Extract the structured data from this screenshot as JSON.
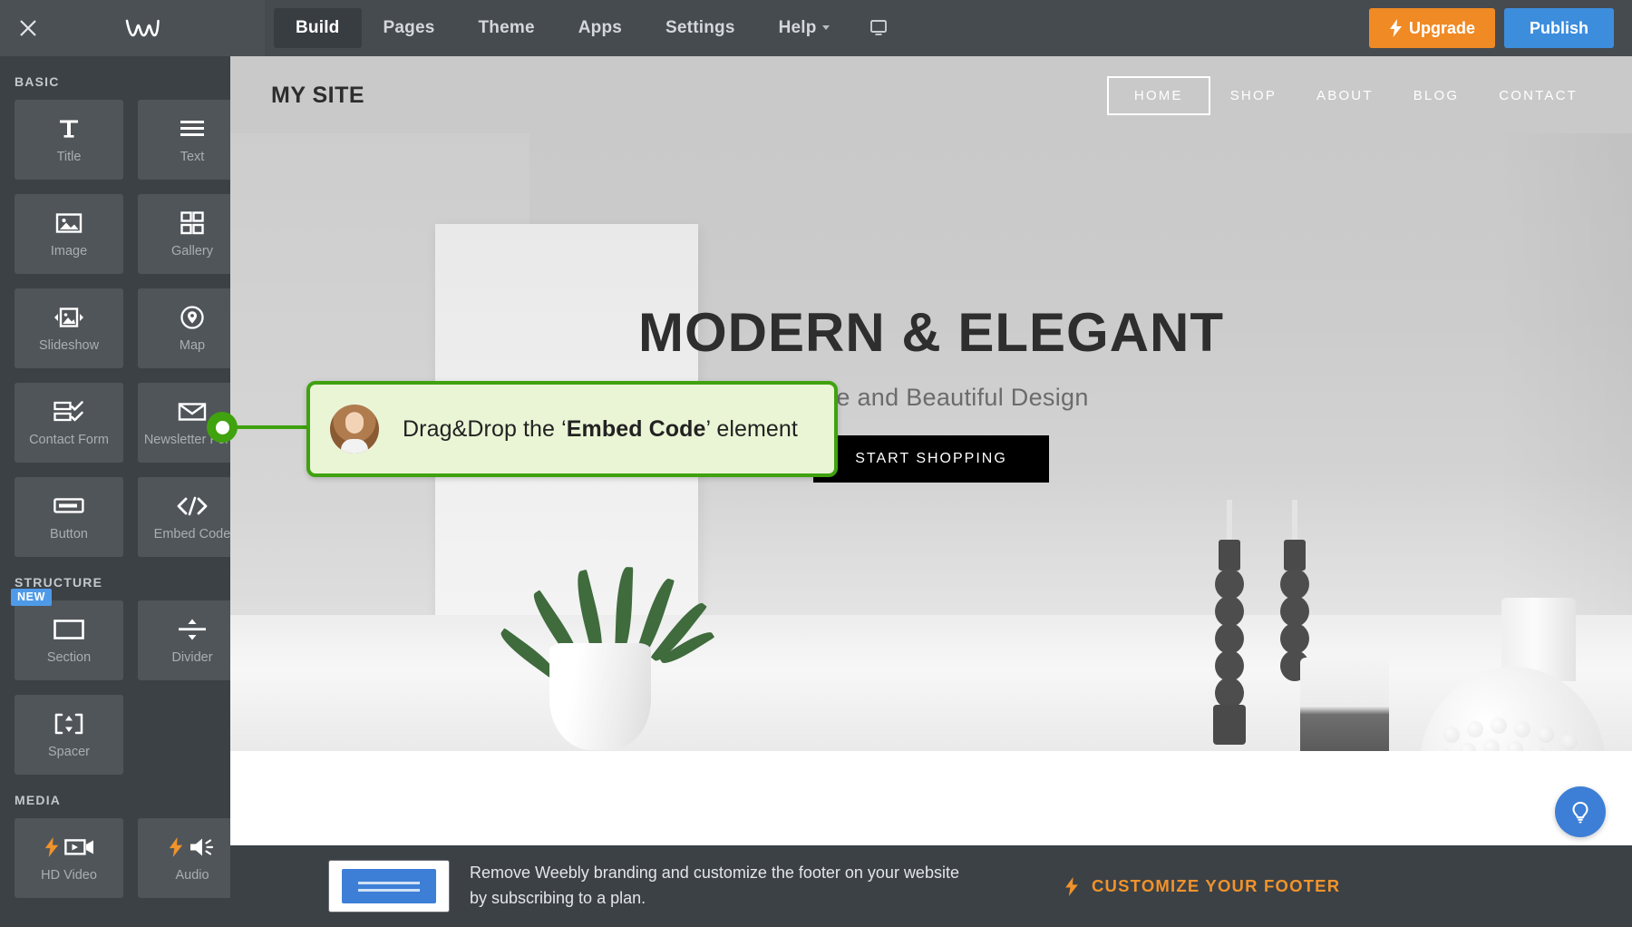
{
  "topbar": {
    "close_icon": "close-icon",
    "logo": "weebly-logo",
    "tabs": [
      {
        "label": "Build",
        "active": true
      },
      {
        "label": "Pages",
        "active": false
      },
      {
        "label": "Theme",
        "active": false
      },
      {
        "label": "Apps",
        "active": false
      },
      {
        "label": "Settings",
        "active": false
      },
      {
        "label": "Help",
        "active": false,
        "has_caret": true
      }
    ],
    "device_picker": {
      "icon": "desktop-monitor-icon",
      "caret": true
    },
    "upgrade_label": "Upgrade",
    "publish_label": "Publish",
    "upgrade_color": "#f08a24",
    "publish_color": "#3d8ddd",
    "active_tab_bg": "#383d42"
  },
  "sidebar": {
    "sections": [
      {
        "title": "BASIC",
        "items": [
          {
            "label": "Title",
            "icon": "title-icon"
          },
          {
            "label": "Text",
            "icon": "text-lines-icon"
          },
          {
            "label": "Image",
            "icon": "image-icon"
          },
          {
            "label": "Gallery",
            "icon": "gallery-grid-icon"
          },
          {
            "label": "Slideshow",
            "icon": "slideshow-icon"
          },
          {
            "label": "Map",
            "icon": "map-pin-icon"
          },
          {
            "label": "Contact Form",
            "icon": "contact-form-icon"
          },
          {
            "label": "Newsletter Form",
            "icon": "envelope-icon"
          },
          {
            "label": "Button",
            "icon": "button-icon"
          },
          {
            "label": "Embed Code",
            "icon": "code-icon"
          }
        ]
      },
      {
        "title": "STRUCTURE",
        "items": [
          {
            "label": "Section",
            "icon": "section-icon",
            "badge": "NEW"
          },
          {
            "label": "Divider",
            "icon": "divider-icon"
          },
          {
            "label": "Spacer",
            "icon": "spacer-icon"
          }
        ]
      },
      {
        "title": "MEDIA",
        "items": [
          {
            "label": "HD Video",
            "icon": "video-camera-icon",
            "pro": true
          },
          {
            "label": "Audio",
            "icon": "speaker-icon",
            "pro": true
          }
        ]
      }
    ]
  },
  "site": {
    "title": "MY SITE",
    "nav": [
      {
        "label": "HOME",
        "current": true
      },
      {
        "label": "SHOP",
        "current": false
      },
      {
        "label": "ABOUT",
        "current": false
      },
      {
        "label": "BLOG",
        "current": false
      },
      {
        "label": "CONTACT",
        "current": false
      }
    ],
    "hero": {
      "heading": "MODERN & ELEGANT",
      "subheading": "Simple and Beautiful Design",
      "cta_label": "START SHOPPING"
    }
  },
  "callout": {
    "avatar": "instructor-avatar",
    "text_before": "Drag&Drop the ‘",
    "text_bold": "Embed Code",
    "text_after": "’ element",
    "accent_color": "#3fa20e",
    "background_color": "#eaf5d6"
  },
  "help_bubble": {
    "icon": "lightbulb-icon",
    "color": "#3d7fd6"
  },
  "bottom_banner": {
    "thumbnail": "website-footer-thumbnail",
    "message": "Remove Weebly branding and customize the footer on your website by subscribing to a plan.",
    "cta_label": "CUSTOMIZE YOUR FOOTER",
    "cta_color": "#f0932b"
  }
}
